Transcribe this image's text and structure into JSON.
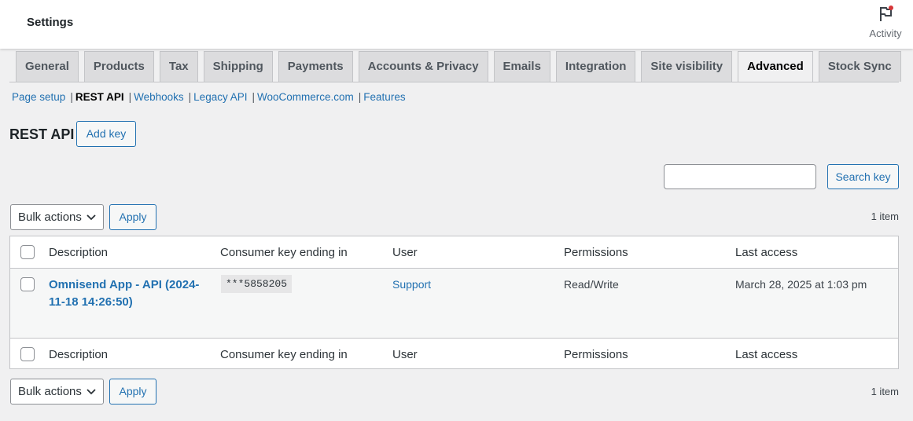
{
  "header": {
    "title": "Settings",
    "activity_label": "Activity"
  },
  "tabs": [
    {
      "label": "General"
    },
    {
      "label": "Products"
    },
    {
      "label": "Tax"
    },
    {
      "label": "Shipping"
    },
    {
      "label": "Payments"
    },
    {
      "label": "Accounts & Privacy"
    },
    {
      "label": "Emails"
    },
    {
      "label": "Integration"
    },
    {
      "label": "Site visibility"
    },
    {
      "label": "Advanced",
      "active": true
    },
    {
      "label": "Stock Sync"
    }
  ],
  "subnav": {
    "items": [
      "Page setup",
      "REST API",
      "Webhooks",
      "Legacy API",
      "WooCommerce.com",
      "Features"
    ],
    "current": "REST API",
    "separator": "|"
  },
  "page": {
    "heading": "REST API",
    "add_key_label": "Add key"
  },
  "search": {
    "value": "",
    "button_label": "Search key"
  },
  "bulk": {
    "select_value": "Bulk actions",
    "apply_label": "Apply",
    "count": "1 item"
  },
  "table": {
    "columns": [
      "Description",
      "Consumer key ending in",
      "User",
      "Permissions",
      "Last access"
    ],
    "rows": [
      {
        "description": "Omnisend App - API (2024-11-18 14:26:50)",
        "consumer_key": "***5858205",
        "user": "Support",
        "permissions": "Read/Write",
        "last_access": "March 28, 2025 at 1:03 pm"
      }
    ]
  },
  "colors": {
    "accent": "#2271b1",
    "background": "#f0f0f1",
    "notification_dot": "#d63638"
  },
  "icons": {
    "activity": "flag-icon",
    "bulk_select": "chevron-down-icon"
  }
}
